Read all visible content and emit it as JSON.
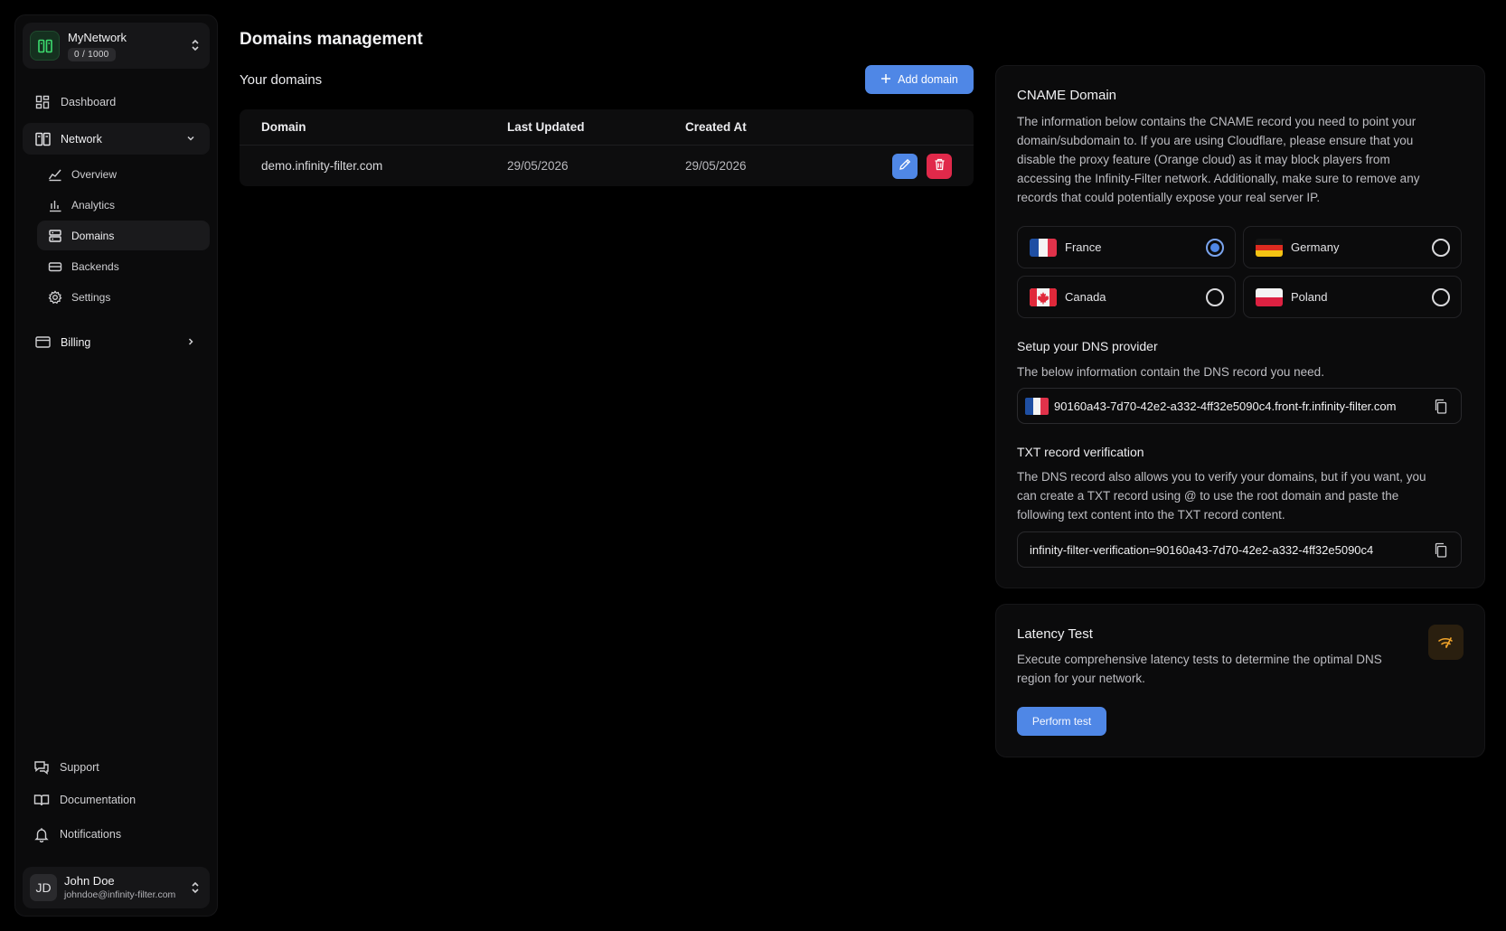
{
  "sidebar": {
    "org": {
      "name": "MyNetwork",
      "quota": "0 / 1000"
    },
    "dashboard": "Dashboard",
    "network": "Network",
    "network_items": [
      {
        "label": "Overview",
        "icon": "overview-chart-icon"
      },
      {
        "label": "Analytics",
        "icon": "bar-chart-icon"
      },
      {
        "label": "Domains",
        "icon": "server-icon"
      },
      {
        "label": "Backends",
        "icon": "drive-icon"
      },
      {
        "label": "Settings",
        "icon": "gear-icon"
      }
    ],
    "billing": "Billing",
    "bottom": [
      {
        "label": "Support",
        "icon": "chat-icon"
      },
      {
        "label": "Documentation",
        "icon": "book-icon"
      },
      {
        "label": "Notifications",
        "icon": "bell-icon"
      }
    ],
    "user": {
      "initials": "JD",
      "name": "John Doe",
      "email": "johndoe@infinity-filter.com"
    }
  },
  "main": {
    "title": "Domains management",
    "section_title": "Your domains",
    "add_button": "Add domain",
    "table": {
      "columns": [
        "Domain",
        "Last Updated",
        "Created At"
      ],
      "rows": [
        {
          "domain": "demo.infinity-filter.com",
          "last_updated": "29/05/2026",
          "created_at": "29/05/2026"
        }
      ]
    }
  },
  "cname": {
    "title": "CNAME Domain",
    "description": "The information below contains the CNAME record you need to point your domain/subdomain to. If you are using Cloudflare, please ensure that you disable the proxy feature (Orange cloud) as it may block players from accessing the Infinity-Filter network. Additionally, make sure to remove any records that could potentially expose your real server IP.",
    "regions": [
      {
        "name": "France",
        "selected": true
      },
      {
        "name": "Germany",
        "selected": false
      },
      {
        "name": "Canada",
        "selected": false
      },
      {
        "name": "Poland",
        "selected": false
      }
    ],
    "dns_title": "Setup your DNS provider",
    "dns_description": "The below information contain the DNS record you need.",
    "dns_value": "90160a43-7d70-42e2-a332-4ff32e5090c4.front-fr.infinity-filter.com",
    "txt_title": "TXT record verification",
    "txt_description": "The DNS record also allows you to verify your domains, but if you want, you can create a TXT record using @ to use the root domain and paste the following text content into the TXT record content.",
    "txt_value": "infinity-filter-verification=90160a43-7d70-42e2-a332-4ff32e5090c4"
  },
  "latency": {
    "title": "Latency Test",
    "description": "Execute comprehensive latency tests to determine the optimal DNS region for your network.",
    "button": "Perform test"
  },
  "colors": {
    "accent": "#4f87e6",
    "danger": "#e0294a",
    "brand_green": "#3ddc6f",
    "warning": "#f0a32a"
  }
}
